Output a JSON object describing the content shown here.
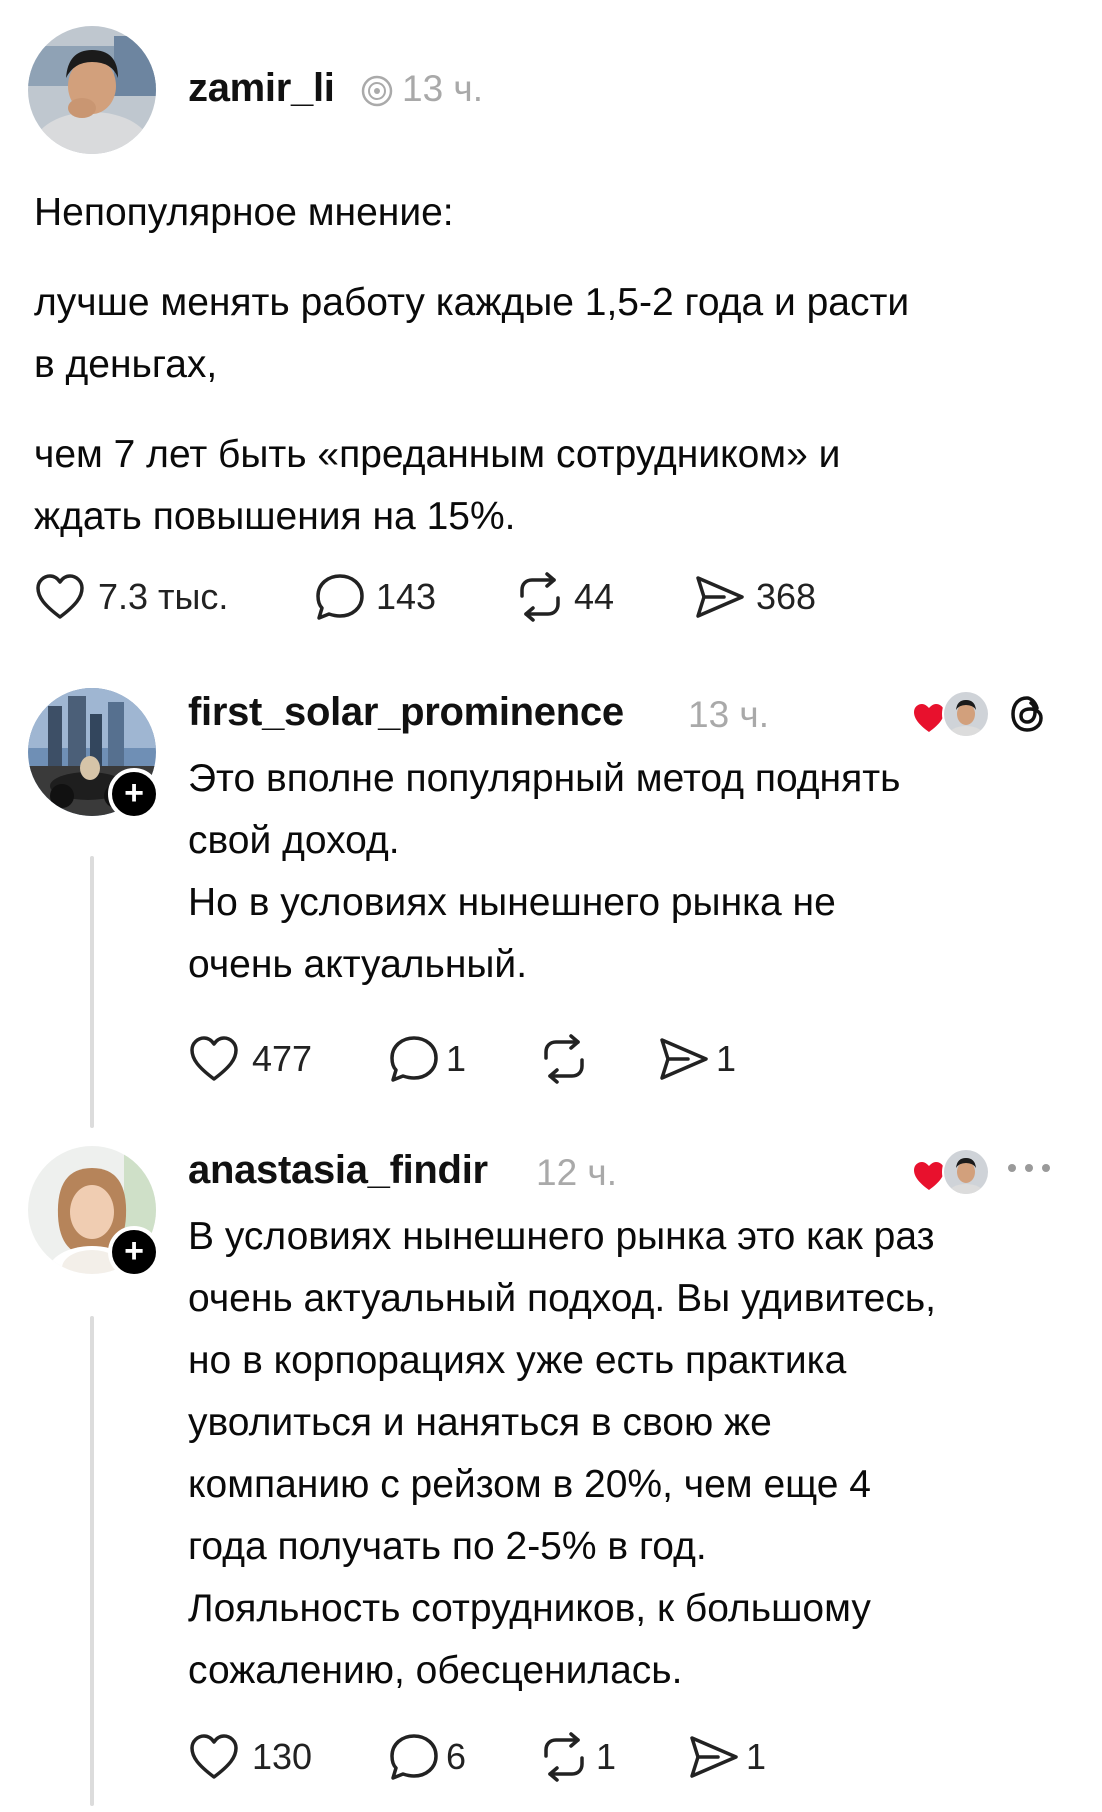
{
  "post": {
    "username": "zamir_li",
    "time": "13 ч.",
    "lines": {
      "title": "Непопулярное мнение:",
      "p1a": "лучше менять работу каждые 1,5-2 года и расти",
      "p1b": "в деньгах,",
      "p2a": "чем 7 лет быть «преданным сотрудником» и",
      "p2b": "ждать повышения на 15%."
    },
    "stats": {
      "likes": "7.3 тыс.",
      "comments": "143",
      "reposts": "44",
      "shares": "368"
    }
  },
  "replies": [
    {
      "username": "first_solar_prominence",
      "time": "13 ч.",
      "lines": {
        "l1": "Это вполне популярный метод поднять",
        "l2": "свой доход.",
        "l3": "Но в условиях нынешнего рынка не",
        "l4": "очень актуальный."
      },
      "stats": {
        "likes": "477",
        "comments": "1",
        "reposts": "",
        "shares": "1"
      }
    },
    {
      "username": "anastasia_findir",
      "time": "12 ч.",
      "lines": {
        "l1": "В условиях нынешнего рынка это как раз",
        "l2": "очень актуальный подход. Вы удивитесь,",
        "l3": "но в корпорациях уже есть практика",
        "l4": "уволиться и наняться в свою же",
        "l5": "компанию с рейзом в 20%, чем еще 4",
        "l6": "года  получать по 2-5% в год.",
        "l7": "Лояльность сотрудников, к большому",
        "l8": "сожалению, обесценилась."
      },
      "stats": {
        "likes": "130",
        "comments": "6",
        "reposts": "1",
        "shares": "1"
      }
    }
  ],
  "icons": {
    "like": "heart-outline-icon",
    "comment": "speech-bubble-icon",
    "repost": "repost-arrows-icon",
    "share": "send-paper-plane-icon",
    "threads": "threads-logo-icon",
    "more": "more-dots-icon",
    "liked_by_author": "red-heart-icon"
  },
  "colors": {
    "accent_red": "#e8112d",
    "text": "#0a0a0a",
    "muted": "#a9a9a9",
    "line": "#dcdcdc"
  }
}
